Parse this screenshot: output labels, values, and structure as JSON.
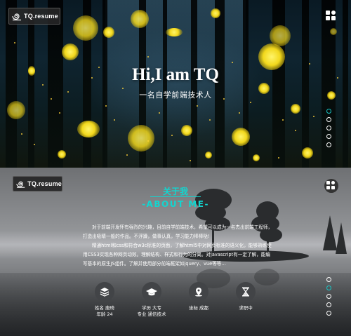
{
  "brand": {
    "name": "TQ.resume"
  },
  "hero": {
    "title": "Hi,I am TQ",
    "subtitle": "一名自学前端技术人"
  },
  "about": {
    "title_cn": "关于我",
    "title_en": "-ABOUT ME-",
    "paragraphs": [
      "对于前端开发怀有强烈的兴趣，目前自学前端技术，希望可以成为一名杰出前端工程师，打造出吸睛一般的作品。不浮躁，做事认真，学习能力棒棒哒!",
      "精通html和css和符合w3c标准的页面，了解html5中对网页标准的语义化，能够熟练使用CSS3实现各种网页动效。理解结构、样式和行为的分离。对javascript有一定了解，能编写基本的原生JS组件。了解并使用部分前端框架如jquery、vue等等…"
    ],
    "info": [
      {
        "icon": "layers-icon",
        "lines": [
          "姓名 唐琦",
          "年龄 24"
        ]
      },
      {
        "icon": "graduation-cap-icon",
        "lines": [
          "学历 大专",
          "专业 通信技术"
        ]
      },
      {
        "icon": "location-pin-icon",
        "lines": [
          "坐标 成都"
        ]
      },
      {
        "icon": "hourglass-icon",
        "lines": [
          "求职中"
        ]
      }
    ]
  },
  "nav_dots": {
    "count": 5,
    "hero_active_index": 0,
    "about_active_index": 1,
    "active_color": "#18c6c6"
  },
  "colors": {
    "accent": "#12d6d0",
    "firefly": "#f2d81c"
  }
}
